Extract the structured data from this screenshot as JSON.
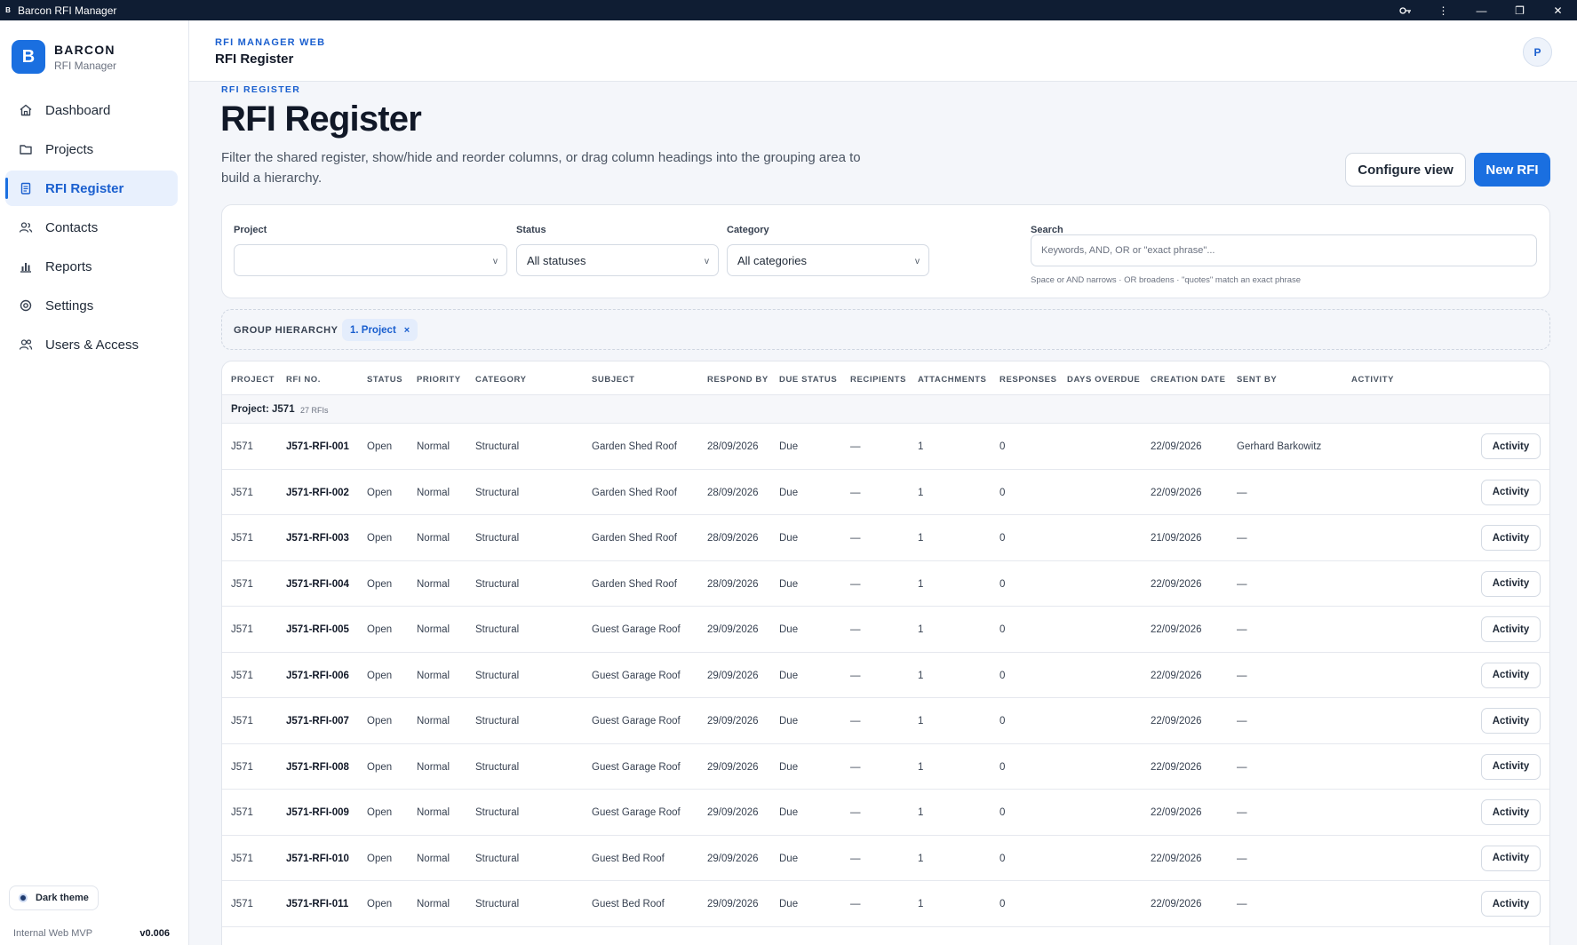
{
  "window": {
    "title": "Barcon RFI Manager"
  },
  "brand": {
    "logo_letter": "B",
    "name": "BARCON",
    "subtitle": "RFI Manager"
  },
  "sidebar": {
    "items": [
      {
        "label": "Dashboard",
        "icon": "home-icon"
      },
      {
        "label": "Projects",
        "icon": "folder-icon"
      },
      {
        "label": "RFI Register",
        "icon": "clipboard-icon",
        "active": true
      },
      {
        "label": "Contacts",
        "icon": "contacts-icon"
      },
      {
        "label": "Reports",
        "icon": "bar-chart-icon"
      },
      {
        "label": "Settings",
        "icon": "gear-icon"
      },
      {
        "label": "Users & Access",
        "icon": "users-icon"
      }
    ],
    "theme_toggle": "Dark theme",
    "footer_left": "Internal Web MVP",
    "footer_version": "v0.006"
  },
  "header": {
    "kicker": "RFI MANAGER WEB",
    "title": "RFI Register",
    "avatar": "P"
  },
  "page": {
    "kicker": "RFI REGISTER",
    "title": "RFI Register",
    "description": "Filter the shared register, show/hide and reorder columns, or drag column headings into the grouping area to build a hierarchy.",
    "configure_button": "Configure view",
    "new_button": "New RFI"
  },
  "filters": {
    "project_label": "Project",
    "project_value": "",
    "status_label": "Status",
    "status_value": "All statuses",
    "category_label": "Category",
    "category_value": "All categories",
    "search_label": "Search",
    "search_placeholder": "Keywords, AND, OR or \"exact phrase\"...",
    "search_hint": "Space or AND narrows · OR broadens · \"quotes\" match an exact phrase"
  },
  "grouping": {
    "label": "GROUP HIERARCHY",
    "chip": "1. Project",
    "chip_remove": "×"
  },
  "table": {
    "columns": [
      "PROJECT",
      "RFI NO.",
      "STATUS",
      "PRIORITY",
      "CATEGORY",
      "SUBJECT",
      "RESPOND BY",
      "DUE STATUS",
      "RECIPIENTS",
      "ATTACHMENTS",
      "RESPONSES",
      "DAYS OVERDUE",
      "CREATION DATE",
      "SENT BY",
      "ACTIVITY"
    ],
    "group": {
      "name": "Project: J571",
      "count": "27 RFIs"
    },
    "activity_label": "Activity",
    "rows": [
      {
        "project": "J571",
        "rfi": "J571-RFI-001",
        "status": "Open",
        "priority": "Normal",
        "category": "Structural",
        "subject": "Garden Shed Roof",
        "respond_by": "28/09/2026",
        "due_status": "Due",
        "recipients": "—",
        "attachments": "1",
        "responses": "0",
        "days_overdue": "",
        "created": "22/09/2026",
        "sent_by": "Gerhard Barkowitz"
      },
      {
        "project": "J571",
        "rfi": "J571-RFI-002",
        "status": "Open",
        "priority": "Normal",
        "category": "Structural",
        "subject": "Garden Shed Roof",
        "respond_by": "28/09/2026",
        "due_status": "Due",
        "recipients": "—",
        "attachments": "1",
        "responses": "0",
        "days_overdue": "",
        "created": "22/09/2026",
        "sent_by": "—"
      },
      {
        "project": "J571",
        "rfi": "J571-RFI-003",
        "status": "Open",
        "priority": "Normal",
        "category": "Structural",
        "subject": "Garden Shed Roof",
        "respond_by": "28/09/2026",
        "due_status": "Due",
        "recipients": "—",
        "attachments": "1",
        "responses": "0",
        "days_overdue": "",
        "created": "21/09/2026",
        "sent_by": "—"
      },
      {
        "project": "J571",
        "rfi": "J571-RFI-004",
        "status": "Open",
        "priority": "Normal",
        "category": "Structural",
        "subject": "Garden Shed Roof",
        "respond_by": "28/09/2026",
        "due_status": "Due",
        "recipients": "—",
        "attachments": "1",
        "responses": "0",
        "days_overdue": "",
        "created": "22/09/2026",
        "sent_by": "—"
      },
      {
        "project": "J571",
        "rfi": "J571-RFI-005",
        "status": "Open",
        "priority": "Normal",
        "category": "Structural",
        "subject": "Guest Garage Roof",
        "respond_by": "29/09/2026",
        "due_status": "Due",
        "recipients": "—",
        "attachments": "1",
        "responses": "0",
        "days_overdue": "",
        "created": "22/09/2026",
        "sent_by": "—"
      },
      {
        "project": "J571",
        "rfi": "J571-RFI-006",
        "status": "Open",
        "priority": "Normal",
        "category": "Structural",
        "subject": "Guest Garage Roof",
        "respond_by": "29/09/2026",
        "due_status": "Due",
        "recipients": "—",
        "attachments": "1",
        "responses": "0",
        "days_overdue": "",
        "created": "22/09/2026",
        "sent_by": "—"
      },
      {
        "project": "J571",
        "rfi": "J571-RFI-007",
        "status": "Open",
        "priority": "Normal",
        "category": "Structural",
        "subject": "Guest Garage Roof",
        "respond_by": "29/09/2026",
        "due_status": "Due",
        "recipients": "—",
        "attachments": "1",
        "responses": "0",
        "days_overdue": "",
        "created": "22/09/2026",
        "sent_by": "—"
      },
      {
        "project": "J571",
        "rfi": "J571-RFI-008",
        "status": "Open",
        "priority": "Normal",
        "category": "Structural",
        "subject": "Guest Garage Roof",
        "respond_by": "29/09/2026",
        "due_status": "Due",
        "recipients": "—",
        "attachments": "1",
        "responses": "0",
        "days_overdue": "",
        "created": "22/09/2026",
        "sent_by": "—"
      },
      {
        "project": "J571",
        "rfi": "J571-RFI-009",
        "status": "Open",
        "priority": "Normal",
        "category": "Structural",
        "subject": "Guest Garage Roof",
        "respond_by": "29/09/2026",
        "due_status": "Due",
        "recipients": "—",
        "attachments": "1",
        "responses": "0",
        "days_overdue": "",
        "created": "22/09/2026",
        "sent_by": "—"
      },
      {
        "project": "J571",
        "rfi": "J571-RFI-010",
        "status": "Open",
        "priority": "Normal",
        "category": "Structural",
        "subject": "Guest Bed Roof",
        "respond_by": "29/09/2026",
        "due_status": "Due",
        "recipients": "—",
        "attachments": "1",
        "responses": "0",
        "days_overdue": "",
        "created": "22/09/2026",
        "sent_by": "—"
      },
      {
        "project": "J571",
        "rfi": "J571-RFI-011",
        "status": "Open",
        "priority": "Normal",
        "category": "Structural",
        "subject": "Guest Bed Roof",
        "respond_by": "29/09/2026",
        "due_status": "Due",
        "recipients": "—",
        "attachments": "1",
        "responses": "0",
        "days_overdue": "",
        "created": "22/09/2026",
        "sent_by": "—"
      }
    ]
  },
  "colors": {
    "accent": "#1a6fe0",
    "titlebar": "#0f1d33",
    "active_nav_bg": "#e8f0fd"
  }
}
